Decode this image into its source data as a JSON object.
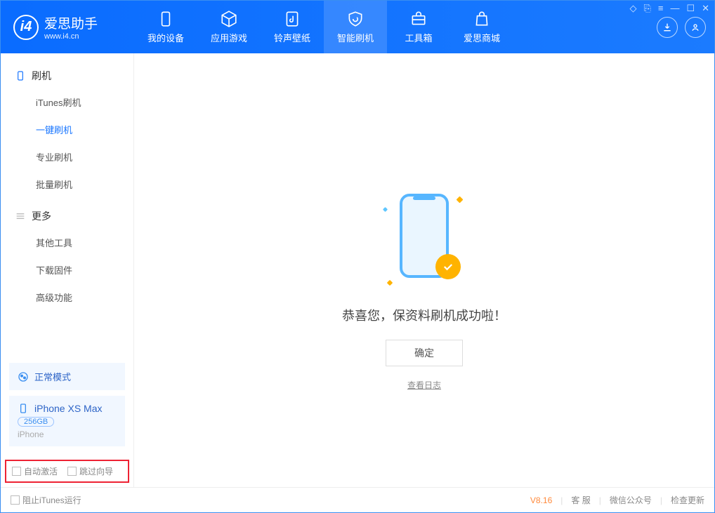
{
  "app": {
    "name_cn": "爱思助手",
    "name_en": "www.i4.cn"
  },
  "nav": {
    "items": [
      {
        "label": "我的设备"
      },
      {
        "label": "应用游戏"
      },
      {
        "label": "铃声壁纸"
      },
      {
        "label": "智能刷机"
      },
      {
        "label": "工具箱"
      },
      {
        "label": "爱思商城"
      }
    ]
  },
  "sidebar": {
    "group1": {
      "title": "刷机",
      "items": [
        "iTunes刷机",
        "一键刷机",
        "专业刷机",
        "批量刷机"
      ]
    },
    "group2": {
      "title": "更多",
      "items": [
        "其他工具",
        "下载固件",
        "高级功能"
      ]
    },
    "mode": "正常模式",
    "device": {
      "name": "iPhone XS Max",
      "storage": "256GB",
      "type": "iPhone"
    },
    "checks": {
      "auto_activate": "自动激活",
      "skip_guide": "跳过向导"
    }
  },
  "main": {
    "success_msg": "恭喜您，保资料刷机成功啦！",
    "ok_button": "确定",
    "log_link": "查看日志"
  },
  "footer": {
    "block_itunes": "阻止iTunes运行",
    "version": "V8.16",
    "links": [
      "客 服",
      "微信公众号",
      "检查更新"
    ]
  }
}
